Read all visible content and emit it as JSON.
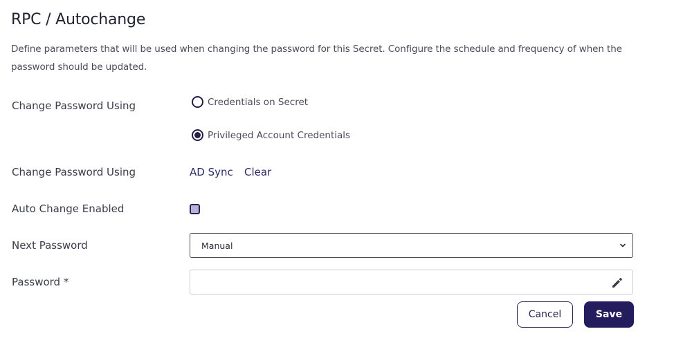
{
  "page": {
    "title": "RPC / Autochange",
    "description": "Define parameters that will be used when changing the password for this Secret. Configure the schedule and frequency of when the password should be updated."
  },
  "form": {
    "change_password_using_label": "Change Password Using",
    "radio_options": [
      {
        "label": "Credentials on Secret",
        "selected": false
      },
      {
        "label": "Privileged Account Credentials",
        "selected": true
      }
    ],
    "change_password_using_label_2": "Change Password Using",
    "ad_sync_link": "AD Sync",
    "clear_link": "Clear",
    "auto_change_label": "Auto Change Enabled",
    "auto_change_checked": true,
    "next_password_label": "Next Password",
    "next_password_value": "Manual",
    "password_label": "Password *",
    "password_value": ""
  },
  "actions": {
    "cancel_label": "Cancel",
    "save_label": "Save"
  },
  "colors": {
    "accent": "#231d5e",
    "checkbox_fill": "#b9b1dc"
  }
}
